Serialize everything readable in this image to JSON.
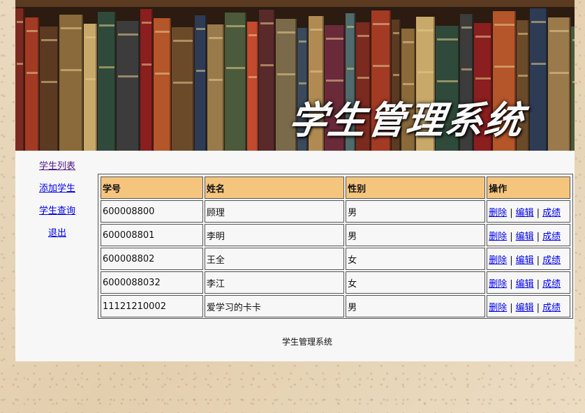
{
  "banner": {
    "title": "学生管理系统"
  },
  "sidebar": {
    "items": [
      {
        "label": "学生列表"
      },
      {
        "label": "添加学生"
      },
      {
        "label": "学生查询"
      },
      {
        "label": "退出"
      }
    ]
  },
  "table": {
    "headers": [
      "学号",
      "姓名",
      "性别",
      "操作"
    ],
    "rows": [
      {
        "id": "600008800",
        "name": "顾理",
        "gender": "男"
      },
      {
        "id": "600008801",
        "name": "李明",
        "gender": "男"
      },
      {
        "id": "600008802",
        "name": "王全",
        "gender": "女"
      },
      {
        "id": "6000088032",
        "name": "李江",
        "gender": "女"
      },
      {
        "id": "11121210002",
        "name": "爱学习的卡卡",
        "gender": "男"
      }
    ],
    "actions": {
      "delete": "删除",
      "edit": "编辑",
      "grades": "成绩",
      "separator": "|"
    }
  },
  "footer": {
    "text": "学生管理系统"
  },
  "colors": {
    "header_bg": "#f5c57e",
    "link": "#0000ee",
    "visited_link": "#551a8b",
    "page_bg": "#f7f7f7"
  }
}
